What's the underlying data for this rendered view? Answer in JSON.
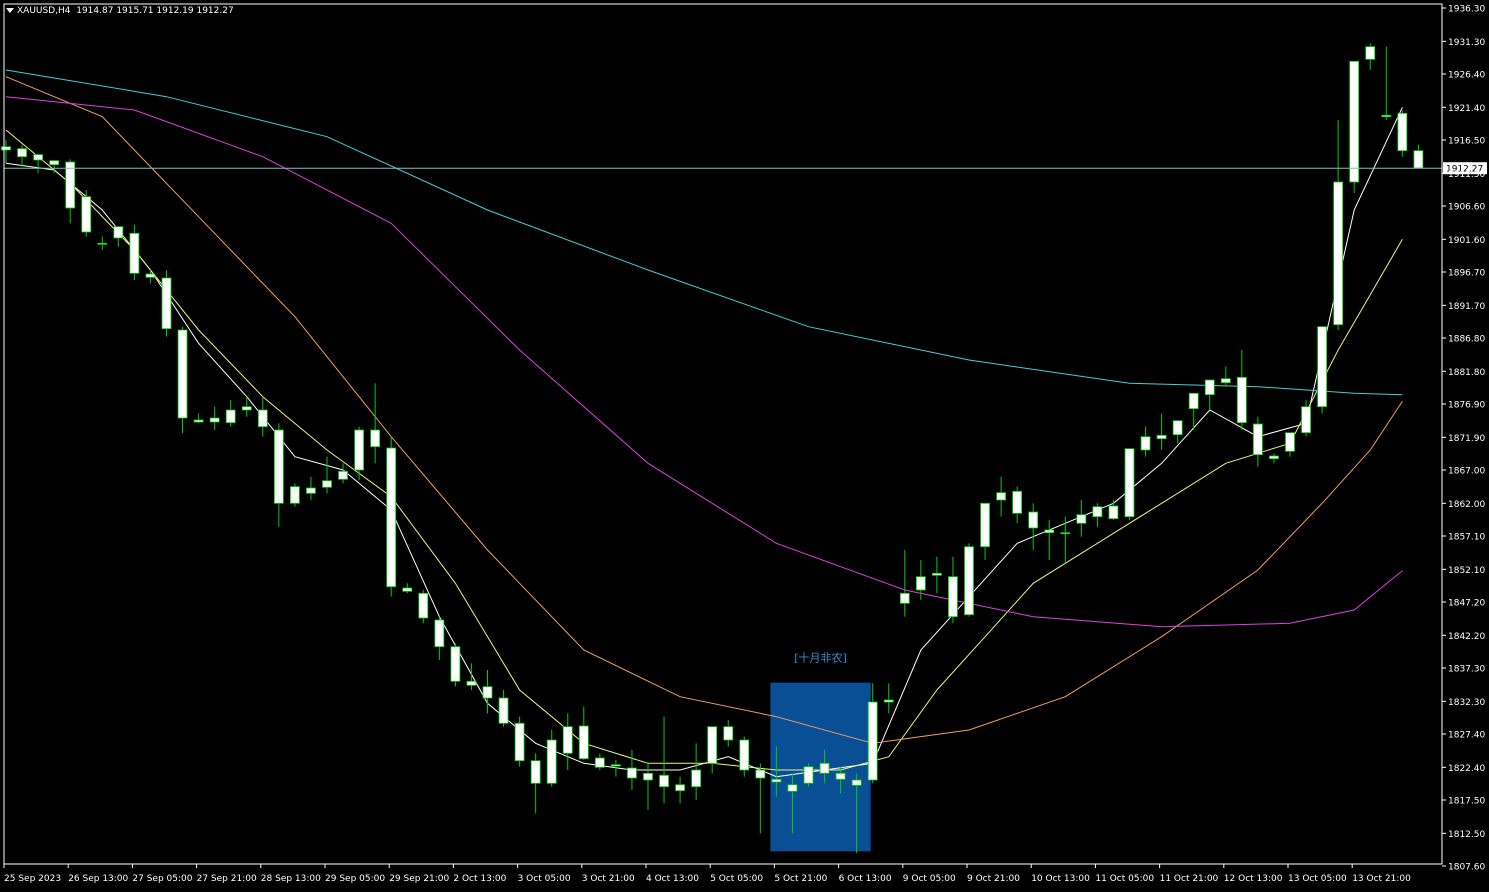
{
  "header": {
    "symbol": "XAUUSD,H4",
    "ohlc": "1914.87 1915.71 1912.19 1912.27"
  },
  "price_tag": "1912.27",
  "annotation": "[十月非农]",
  "colors": {
    "background": "#000000",
    "axis": "#ffffff",
    "candle_body": "#ffffff",
    "candle_wick": "#00d000",
    "price_line": "#7fbfbf",
    "highlight_box": "#0a4f96",
    "annotation": "#3a8fd8",
    "ma_white": "#ffffff",
    "ma_yellow": "#f2f27a",
    "ma_orange": "#f0a25a",
    "ma_magenta": "#e040e0",
    "ma_cyan": "#40d0d8"
  },
  "chart_data": {
    "type": "candlestick",
    "ylim": [
      1807.6,
      1936.3
    ],
    "yticks": [
      1936.3,
      1931.3,
      1926.4,
      1921.4,
      1916.5,
      1911.5,
      1906.6,
      1901.6,
      1896.7,
      1891.7,
      1886.8,
      1881.8,
      1876.9,
      1871.9,
      1867.0,
      1862.0,
      1857.1,
      1852.1,
      1847.2,
      1842.2,
      1837.3,
      1832.3,
      1827.4,
      1822.4,
      1817.5,
      1812.5,
      1807.6
    ],
    "ytick_labels": [
      "1936.30",
      "1931.30",
      "1926.40",
      "1921.40",
      "1916.50",
      "1911.50",
      "1906.60",
      "1901.60",
      "1896.70",
      "1891.70",
      "1886.80",
      "1881.80",
      "1876.90",
      "1871.90",
      "1867.00",
      "1862.00",
      "1857.10",
      "1852.10",
      "1847.20",
      "1842.20",
      "1837.30",
      "1832.30",
      "1827.40",
      "1822.40",
      "1817.50",
      "1812.50",
      "1807.60"
    ],
    "xtick_labels": [
      "25 Sep 2023",
      "26 Sep 13:00",
      "27 Sep 05:00",
      "27 Sep 21:00",
      "28 Sep 13:00",
      "29 Sep 05:00",
      "29 Sep 21:00",
      "2 Oct 13:00",
      "3 Oct 05:00",
      "3 Oct 21:00",
      "4 Oct 13:00",
      "5 Oct 05:00",
      "5 Oct 21:00",
      "6 Oct 13:00",
      "9 Oct 05:00",
      "9 Oct 21:00",
      "10 Oct 13:00",
      "11 Oct 05:00",
      "11 Oct 21:00",
      "12 Oct 13:00",
      "13 Oct 05:00",
      "13 Oct 21:00"
    ],
    "xtick_bar_index": [
      0,
      4,
      8,
      12,
      16,
      20,
      24,
      28,
      32,
      36,
      40,
      44,
      48,
      52,
      56,
      60,
      64,
      68,
      72,
      76,
      80,
      84
    ],
    "current_price": 1912.27,
    "candles": [
      [
        1915.0,
        1916.5,
        1913.0,
        1915.5
      ],
      [
        1914.0,
        1915.8,
        1912.5,
        1915.2
      ],
      [
        1913.5,
        1914.5,
        1911.5,
        1914.3
      ],
      [
        1912.8,
        1913.5,
        1911.5,
        1913.4
      ],
      [
        1913.2,
        1913.6,
        1904.0,
        1906.3
      ],
      [
        1908.0,
        1909.0,
        1902.0,
        1902.7
      ],
      [
        1901.0,
        1902.0,
        1900.0,
        1900.9
      ],
      [
        1901.8,
        1903.0,
        1900.5,
        1903.5
      ],
      [
        1902.5,
        1903.8,
        1895.5,
        1896.5
      ],
      [
        1896.4,
        1897.0,
        1895.0,
        1895.9
      ],
      [
        1895.8,
        1897.0,
        1887.0,
        1888.2
      ],
      [
        1888.0,
        1888.5,
        1872.5,
        1874.8
      ],
      [
        1874.5,
        1875.5,
        1874.0,
        1874.2
      ],
      [
        1874.2,
        1876.5,
        1873.0,
        1874.8
      ],
      [
        1874.1,
        1877.5,
        1873.5,
        1876.0
      ],
      [
        1876.0,
        1878.0,
        1875.0,
        1876.5
      ],
      [
        1876.0,
        1878.0,
        1872.0,
        1873.5
      ],
      [
        1873.0,
        1874.0,
        1858.5,
        1862.0
      ],
      [
        1862.0,
        1865.0,
        1861.5,
        1864.5
      ],
      [
        1863.5,
        1866.0,
        1862.5,
        1864.3
      ],
      [
        1864.4,
        1869.0,
        1863.5,
        1865.4
      ],
      [
        1865.6,
        1868.0,
        1865.0,
        1866.8
      ],
      [
        1867.0,
        1873.5,
        1865.5,
        1873.0
      ],
      [
        1873.0,
        1880.0,
        1868.0,
        1870.5
      ],
      [
        1870.3,
        1872.0,
        1848.0,
        1849.5
      ],
      [
        1849.3,
        1850.0,
        1848.5,
        1848.8
      ],
      [
        1848.5,
        1849.0,
        1844.0,
        1844.8
      ],
      [
        1844.5,
        1845.0,
        1838.5,
        1840.5
      ],
      [
        1840.5,
        1841.0,
        1834.5,
        1835.3
      ],
      [
        1835.3,
        1838.0,
        1834.0,
        1834.7
      ],
      [
        1834.5,
        1837.0,
        1830.5,
        1832.8
      ],
      [
        1832.8,
        1834.0,
        1828.5,
        1829.0
      ],
      [
        1829.0,
        1830.0,
        1822.5,
        1823.4
      ],
      [
        1823.4,
        1824.5,
        1815.5,
        1820.0
      ],
      [
        1820.0,
        1828.0,
        1819.5,
        1826.5
      ],
      [
        1824.5,
        1830.5,
        1822.0,
        1828.5
      ],
      [
        1828.6,
        1831.5,
        1823.5,
        1823.7
      ],
      [
        1823.8,
        1824.5,
        1822.0,
        1822.4
      ],
      [
        1822.6,
        1823.5,
        1821.0,
        1822.8
      ],
      [
        1822.3,
        1825.0,
        1819.0,
        1820.8
      ],
      [
        1820.5,
        1823.0,
        1816.0,
        1821.5
      ],
      [
        1821.2,
        1830.0,
        1817.0,
        1819.5
      ],
      [
        1818.9,
        1821.0,
        1817.0,
        1819.8
      ],
      [
        1819.5,
        1826.0,
        1817.5,
        1822.0
      ],
      [
        1823.0,
        1828.0,
        1821.5,
        1828.5
      ],
      [
        1828.5,
        1829.5,
        1825.5,
        1826.5
      ],
      [
        1826.5,
        1827.0,
        1821.0,
        1822.0
      ],
      [
        1822.0,
        1823.0,
        1812.5,
        1820.8
      ],
      [
        1820.6,
        1825.5,
        1818.0,
        1820.2
      ],
      [
        1818.8,
        1821.5,
        1812.5,
        1819.8
      ],
      [
        1820.0,
        1823.0,
        1819.5,
        1822.5
      ],
      [
        1823.0,
        1825.0,
        1820.0,
        1821.5
      ],
      [
        1821.5,
        1822.5,
        1818.5,
        1820.6
      ],
      [
        1819.7,
        1821.5,
        1809.5,
        1820.5
      ],
      [
        1820.5,
        1835.0,
        1820.0,
        1832.2
      ],
      [
        1832.2,
        1835.0,
        1830.5,
        1832.5
      ],
      [
        1847.0,
        1855.0,
        1845.0,
        1848.5
      ],
      [
        1849.0,
        1853.5,
        1847.5,
        1851.0
      ],
      [
        1851.5,
        1854.0,
        1848.5,
        1851.2
      ],
      [
        1851.0,
        1854.0,
        1844.0,
        1845.0
      ],
      [
        1845.3,
        1856.0,
        1845.0,
        1855.5
      ],
      [
        1855.5,
        1861.5,
        1853.5,
        1862.0
      ],
      [
        1862.5,
        1866.0,
        1860.0,
        1863.6
      ],
      [
        1863.8,
        1864.5,
        1859.0,
        1860.5
      ],
      [
        1860.7,
        1862.0,
        1855.0,
        1858.3
      ],
      [
        1858.0,
        1859.5,
        1853.5,
        1857.6
      ],
      [
        1857.6,
        1860.0,
        1853.0,
        1857.5
      ],
      [
        1859.0,
        1862.5,
        1857.0,
        1860.3
      ],
      [
        1860.0,
        1862.0,
        1858.5,
        1861.5
      ],
      [
        1861.6,
        1862.5,
        1859.5,
        1859.7
      ],
      [
        1860.0,
        1869.5,
        1859.5,
        1870.2
      ],
      [
        1870.0,
        1873.5,
        1869.0,
        1872.0
      ],
      [
        1871.7,
        1875.5,
        1870.0,
        1872.2
      ],
      [
        1872.3,
        1874.5,
        1871.0,
        1874.4
      ],
      [
        1876.2,
        1877.5,
        1873.0,
        1878.5
      ],
      [
        1878.3,
        1880.0,
        1876.0,
        1880.5
      ],
      [
        1880.1,
        1882.5,
        1879.5,
        1880.7
      ],
      [
        1880.9,
        1885.0,
        1873.0,
        1874.1
      ],
      [
        1873.9,
        1875.0,
        1867.5,
        1869.3
      ],
      [
        1869.1,
        1869.5,
        1868.0,
        1868.7
      ],
      [
        1869.8,
        1871.5,
        1869.0,
        1872.6
      ],
      [
        1872.6,
        1877.5,
        1872.0,
        1876.5
      ],
      [
        1876.5,
        1888.5,
        1875.5,
        1888.5
      ],
      [
        1888.8,
        1919.5,
        1888.0,
        1910.2
      ],
      [
        1910.2,
        1918.0,
        1908.5,
        1928.3
      ],
      [
        1928.6,
        1931.0,
        1927.0,
        1930.5
      ],
      [
        1920.0,
        1930.5,
        1919.5,
        1920.2
      ],
      [
        1920.5,
        1921.0,
        1914.0,
        1914.9
      ],
      [
        1914.9,
        1915.8,
        1912.2,
        1912.3
      ]
    ],
    "moving_averages": [
      {
        "color": "#ffffff",
        "values": [
          [
            0,
            1913.0
          ],
          [
            3,
            1912.0
          ],
          [
            6,
            1906.0
          ],
          [
            9,
            1897.0
          ],
          [
            12,
            1886.0
          ],
          [
            15,
            1878.0
          ],
          [
            18,
            1869.0
          ],
          [
            21,
            1867.0
          ],
          [
            24,
            1861.0
          ],
          [
            27,
            1845.0
          ],
          [
            30,
            1832.0
          ],
          [
            33,
            1826.0
          ],
          [
            36,
            1823.0
          ],
          [
            39,
            1822.0
          ],
          [
            42,
            1822.0
          ],
          [
            45,
            1824.0
          ],
          [
            48,
            1821.0
          ],
          [
            51,
            1822.0
          ],
          [
            54,
            1823.0
          ],
          [
            57,
            1840.0
          ],
          [
            60,
            1848.0
          ],
          [
            63,
            1856.0
          ],
          [
            66,
            1859.0
          ],
          [
            69,
            1862.0
          ],
          [
            72,
            1868.0
          ],
          [
            75,
            1876.0
          ],
          [
            78,
            1872.0
          ],
          [
            81,
            1874.0
          ],
          [
            84,
            1906.0
          ],
          [
            87,
            1921.4
          ]
        ]
      },
      {
        "color": "#f2f27a",
        "values": [
          [
            0,
            1918.0
          ],
          [
            4,
            1910.0
          ],
          [
            8,
            1900.0
          ],
          [
            12,
            1888.0
          ],
          [
            16,
            1878.0
          ],
          [
            20,
            1870.0
          ],
          [
            24,
            1863.0
          ],
          [
            28,
            1850.0
          ],
          [
            32,
            1834.0
          ],
          [
            36,
            1826.0
          ],
          [
            40,
            1823.0
          ],
          [
            44,
            1823.0
          ],
          [
            48,
            1822.0
          ],
          [
            52,
            1822.0
          ],
          [
            55,
            1824.0
          ],
          [
            58,
            1834.0
          ],
          [
            61,
            1842.0
          ],
          [
            64,
            1850.0
          ],
          [
            68,
            1856.0
          ],
          [
            72,
            1862.0
          ],
          [
            76,
            1868.0
          ],
          [
            80,
            1871.0
          ],
          [
            83,
            1885.0
          ],
          [
            87,
            1901.6
          ]
        ]
      },
      {
        "color": "#f0a25a",
        "values": [
          [
            0,
            1926.0
          ],
          [
            6,
            1920.0
          ],
          [
            12,
            1905.0
          ],
          [
            18,
            1890.0
          ],
          [
            24,
            1872.0
          ],
          [
            30,
            1855.0
          ],
          [
            36,
            1840.0
          ],
          [
            42,
            1833.0
          ],
          [
            48,
            1830.0
          ],
          [
            54,
            1826.0
          ],
          [
            60,
            1828.0
          ],
          [
            66,
            1833.0
          ],
          [
            72,
            1842.0
          ],
          [
            78,
            1852.0
          ],
          [
            82,
            1862.0
          ],
          [
            85,
            1870.0
          ],
          [
            87,
            1877.3
          ]
        ]
      },
      {
        "color": "#e040e0",
        "values": [
          [
            0,
            1923.0
          ],
          [
            8,
            1921.0
          ],
          [
            16,
            1914.0
          ],
          [
            24,
            1904.0
          ],
          [
            32,
            1885.0
          ],
          [
            40,
            1868.0
          ],
          [
            48,
            1856.0
          ],
          [
            56,
            1849.0
          ],
          [
            64,
            1845.0
          ],
          [
            72,
            1843.5
          ],
          [
            80,
            1844.0
          ],
          [
            84,
            1846.0
          ],
          [
            87,
            1851.9
          ]
        ]
      },
      {
        "color": "#40d0d8",
        "values": [
          [
            0,
            1927.0
          ],
          [
            10,
            1923.0
          ],
          [
            20,
            1917.0
          ],
          [
            30,
            1906.0
          ],
          [
            40,
            1897.0
          ],
          [
            50,
            1888.5
          ],
          [
            60,
            1883.5
          ],
          [
            70,
            1880.0
          ],
          [
            78,
            1879.5
          ],
          [
            84,
            1878.5
          ],
          [
            87,
            1878.3
          ]
        ]
      }
    ]
  }
}
